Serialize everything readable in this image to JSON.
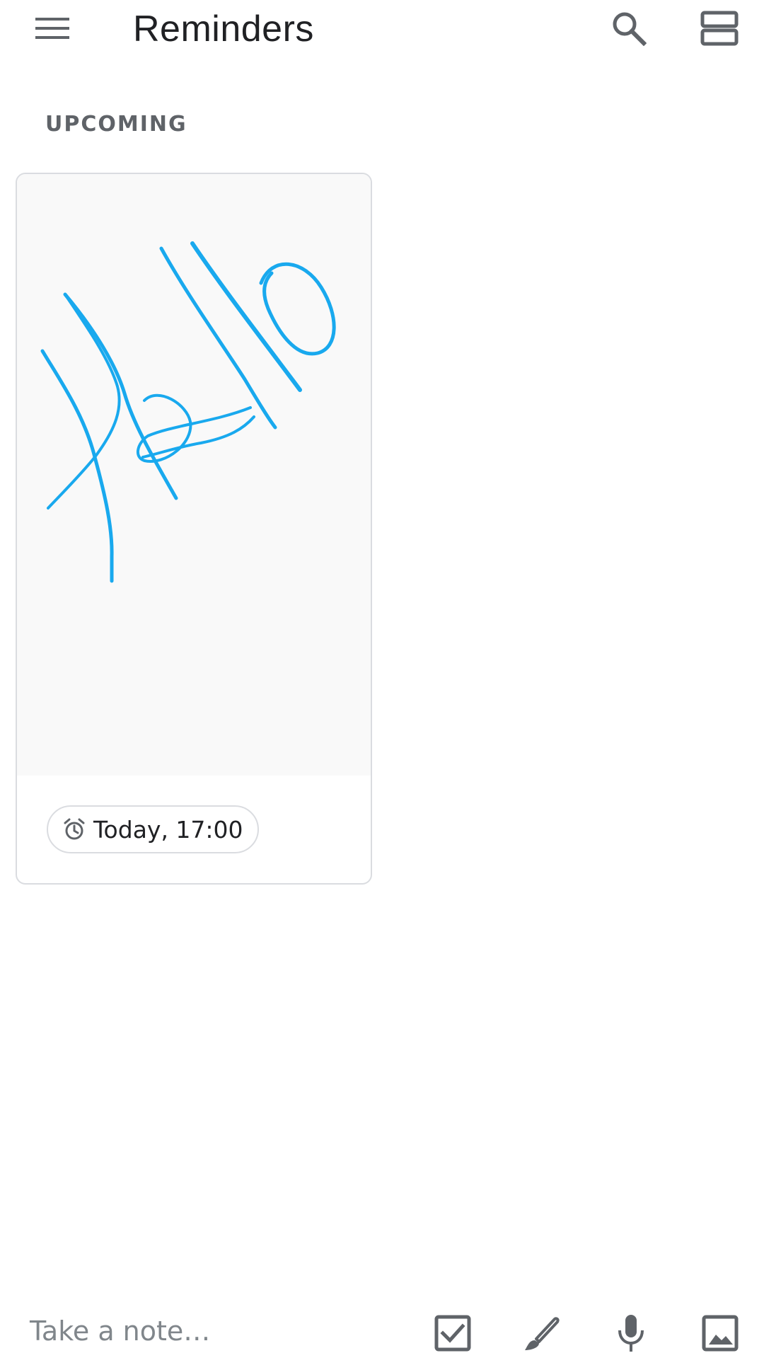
{
  "header": {
    "title": "Reminders",
    "menu_icon": "hamburger-menu-icon",
    "search_icon": "search-icon",
    "layout_icon": "view-list-icon"
  },
  "section": {
    "label": "UPCOMING"
  },
  "note": {
    "handwriting_text": "Hello",
    "ink_color": "#19a9ee",
    "reminder": {
      "icon": "alarm-clock-icon",
      "label": "Today, 17:00"
    }
  },
  "bottom_bar": {
    "placeholder": "Take a note…",
    "actions": [
      {
        "icon": "checkbox-icon",
        "name": "new-list"
      },
      {
        "icon": "brush-icon",
        "name": "new-drawing"
      },
      {
        "icon": "microphone-icon",
        "name": "new-audio-note"
      },
      {
        "icon": "image-icon",
        "name": "new-image-note"
      }
    ]
  },
  "colors": {
    "text_primary": "#202124",
    "text_secondary": "#5f6368",
    "placeholder": "#80868b",
    "border": "#dadce0",
    "drawing_bg": "#f9f9f9"
  }
}
